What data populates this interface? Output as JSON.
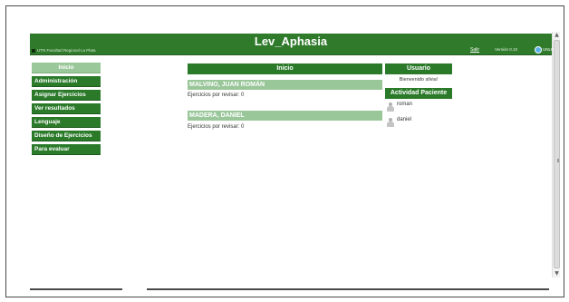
{
  "header": {
    "title": "Lev_Aphasia",
    "org_label": "UTN Facultad Regional La Plata",
    "logout_label": "Salir",
    "version_label": "Versión 0.10",
    "partner_label": "UNLP"
  },
  "sidebar": {
    "items": [
      {
        "label": "Inicio"
      },
      {
        "label": "Administración"
      },
      {
        "label": "Asignar Ejercicios"
      },
      {
        "label": "Ver resultados"
      },
      {
        "label": "Lenguaje"
      },
      {
        "label": "Diseño de Ejercicios"
      },
      {
        "label": "Para evaluar"
      }
    ]
  },
  "main": {
    "heading": "Inicio",
    "patients": [
      {
        "name": "MALVINO, JUAN ROMÁN",
        "pending": "Ejercicios por revisar: 0"
      },
      {
        "name": "MADERA, DANIEL",
        "pending": "Ejercicios por revisar: 0"
      }
    ]
  },
  "user_panel": {
    "heading": "Usuario",
    "welcome": "Bienvenido silvia!",
    "activity_heading": "Actividad Paciente",
    "active_users": [
      {
        "name": "roman",
        "icon": "user-silhouette-icon"
      },
      {
        "name": "daniel",
        "icon": "user-silhouette-icon"
      }
    ]
  },
  "colors": {
    "brand_green": "#2f7a2b",
    "nav_green": "#2a7a2a",
    "light_green": "#9ac79a"
  }
}
